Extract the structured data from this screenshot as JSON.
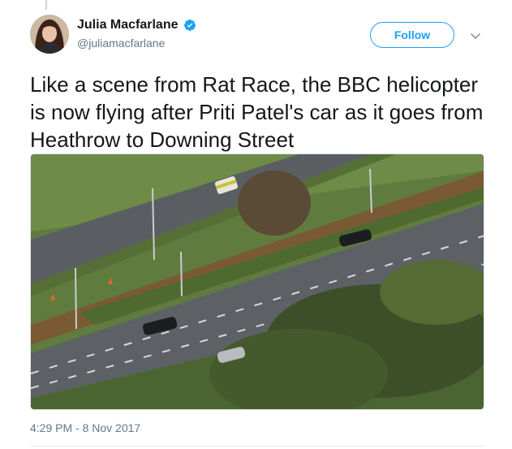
{
  "tweet": {
    "author": {
      "display_name": "Julia Macfarlane",
      "handle": "@juliamacfarlane",
      "verified": true
    },
    "follow_label": "Follow",
    "text": "Like a scene from Rat Race, the BBC helicopter is now flying after Priti Patel's car as it goes from Heathrow to Downing Street",
    "timestamp": "4:29 PM - 8 Nov 2017",
    "media_icon": "aerial-photo"
  },
  "colors": {
    "accent": "#1da1f2",
    "text": "#14171a",
    "muted": "#657786"
  },
  "icons": {
    "verified": "verified-badge-icon",
    "caret": "chevron-down-icon"
  }
}
